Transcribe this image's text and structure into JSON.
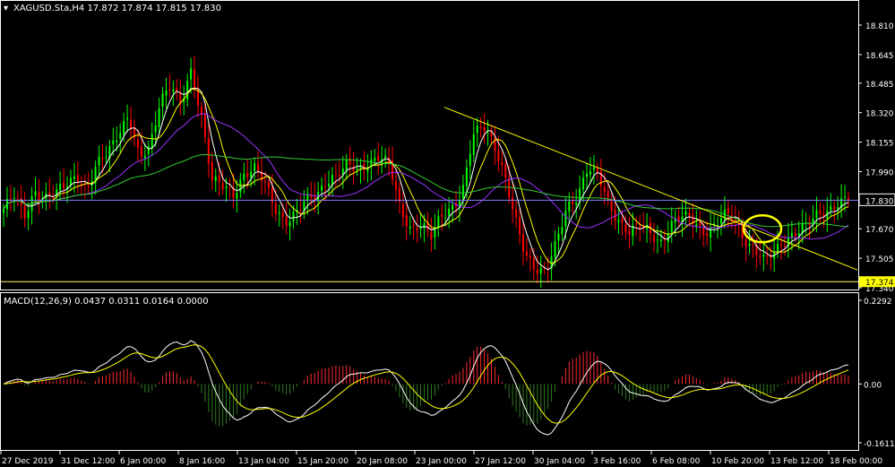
{
  "header": {
    "title_text": "XAGUSD.Sta,H4  17.872 17.874 17.815 17.830",
    "macd_label": "MACD(12,26,9) 0.0437 0.0311 0.0164 0.0000"
  },
  "colors": {
    "background": "#000000",
    "bull_candle": "#00ff00",
    "bear_candle": "#ff0000",
    "ma_fast": "#ffffff",
    "ma_mid": "#ffff00",
    "ma_slow": "#9a33ff",
    "ma_long": "#33cc33",
    "trendline": "#ffff00",
    "current_price_line": "#8080ff",
    "support_line": "#ffff66",
    "macd_hist_pos": "#ff2a2a",
    "macd_hist_neg": "#2e7d1e",
    "macd_line": "#ffffff",
    "signal_line": "#ffff00",
    "highlight_circle": "#ffff00"
  },
  "price_axis": {
    "ticks": [
      "18.810",
      "18.645",
      "18.485",
      "18.320",
      "18.155",
      "17.990",
      "17.830",
      "17.670",
      "17.505",
      "17.340"
    ],
    "current_price_label": "17.830",
    "support_label": "17.374"
  },
  "macd_axis": {
    "ticks": [
      "0.2292",
      "0.00",
      "-0.1611"
    ]
  },
  "time_axis": {
    "labels": [
      "27 Dec 2019",
      "31 Dec 12:00",
      "6 Jan 00:00",
      "8 Jan 16:00",
      "13 Jan 04:00",
      "15 Jan 20:00",
      "20 Jan 08:00",
      "23 Jan 00:00",
      "27 Jan 12:00",
      "30 Jan 04:00",
      "3 Feb 16:00",
      "6 Feb 08:00",
      "10 Feb 20:00",
      "13 Feb 12:00",
      "18 Feb 00:00"
    ]
  },
  "chart_data": {
    "type": "candlestick",
    "symbol": "XAGUSD.Sta",
    "timeframe": "H4",
    "last_ohlc": {
      "open": 17.872,
      "high": 17.874,
      "low": 17.815,
      "close": 17.83
    },
    "ylim": [
      17.34,
      18.81
    ],
    "close_path": [
      17.78,
      17.85,
      17.74,
      17.89,
      17.84,
      17.86,
      17.92,
      17.98,
      17.88,
      18.02,
      18.1,
      18.22,
      18.3,
      18.05,
      18.12,
      18.4,
      18.48,
      18.35,
      18.55,
      18.3,
      17.95,
      17.9,
      17.85,
      17.98,
      18.02,
      17.92,
      17.78,
      17.72,
      17.76,
      17.82,
      17.85,
      17.95,
      17.98,
      18.02,
      17.99,
      18.05,
      18.08,
      18.02,
      17.78,
      17.68,
      17.7,
      17.62,
      17.74,
      17.8,
      17.88,
      18.18,
      18.24,
      18.16,
      17.98,
      17.72,
      17.52,
      17.46,
      17.44,
      17.58,
      17.78,
      17.86,
      18.02,
      17.96,
      17.8,
      17.72,
      17.66,
      17.68,
      17.64,
      17.6,
      17.7,
      17.73,
      17.72,
      17.66,
      17.68,
      17.74,
      17.72,
      17.62,
      17.56,
      17.48,
      17.54,
      17.62,
      17.66,
      17.68,
      17.74,
      17.78,
      17.82,
      17.83
    ],
    "support_level": 17.374,
    "current_price": 17.83,
    "trendline": {
      "start_price": 18.35,
      "end_price": 17.44
    },
    "macd": {
      "fast": 12,
      "slow": 26,
      "signal": 9,
      "values": [
        0.0437,
        0.0311,
        0.0164,
        0.0
      ]
    },
    "macd_ylim": [
      -0.1611,
      0.2292
    ]
  }
}
